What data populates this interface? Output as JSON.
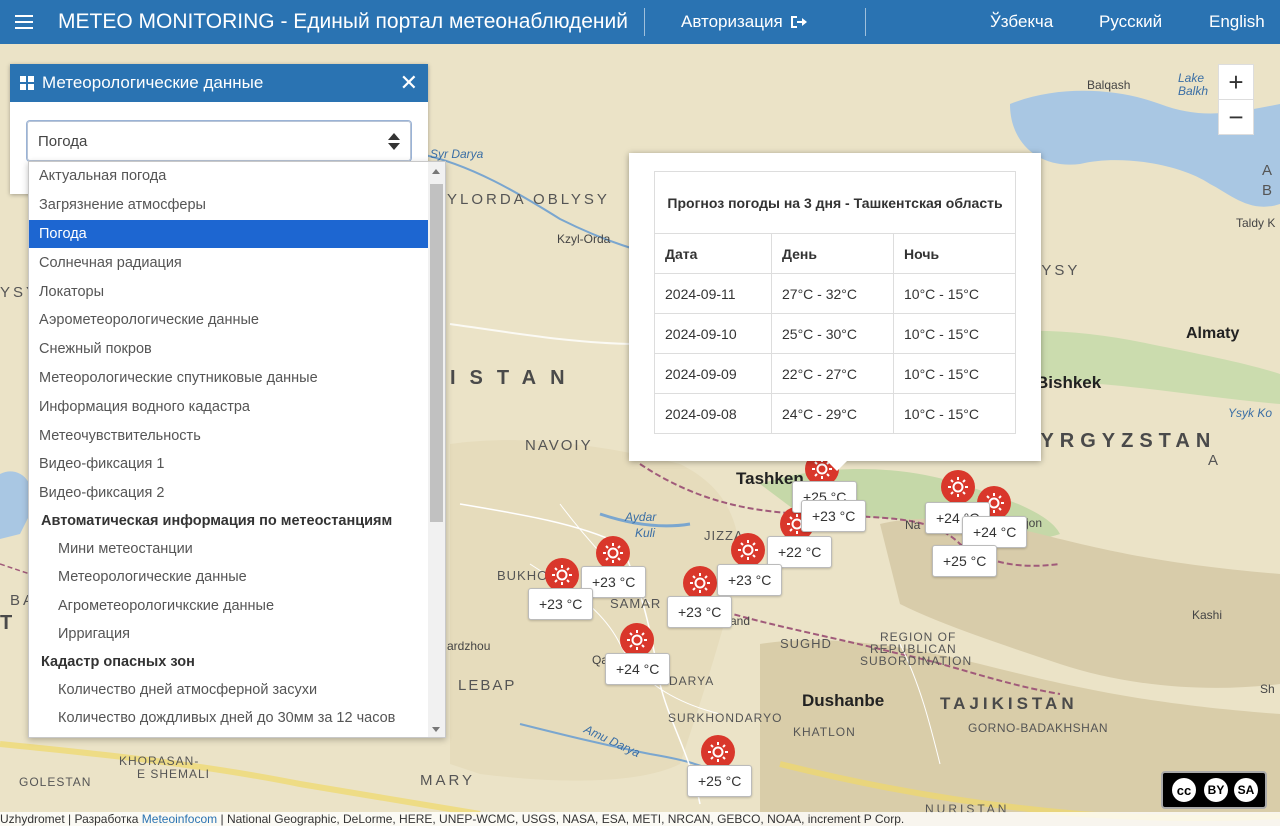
{
  "header": {
    "title": "METEO MONITORING - Единый портал метеонаблюдений",
    "login_label": "Авторизация",
    "languages": [
      "Ўзбекча",
      "Русский",
      "English"
    ]
  },
  "panel": {
    "title": "Метеорологические данные",
    "select_value": "Погода"
  },
  "dropdown": {
    "items": [
      "Актуальная погода",
      "Загрязнение атмосферы",
      "Погода",
      "Солнечная радиация",
      "Локаторы",
      "Аэрометеорологические данные",
      "Снежный покров",
      "Метеорологические спутниковые данные",
      "Информация водного кадастра",
      "Метеочувствительность",
      "Видео-фиксация 1",
      "Видео-фиксация 2"
    ],
    "selected_index": 2,
    "group1": {
      "title": "Автоматическая информация по метеостанциям",
      "items": [
        "Мини метеостанции",
        "Метеорологические данные",
        "Агрометеорологичкские данные",
        "Ирригация"
      ]
    },
    "group2": {
      "title": "Кадастр опасных зон",
      "items": [
        "Количество дней атмосферной засухи",
        "Количество дождливых дней до 30мм за 12 часов"
      ]
    }
  },
  "forecast": {
    "title": "Прогноз погоды на 3 дня - Ташкентская область",
    "headers": [
      "Дата",
      "День",
      "Ночь"
    ],
    "rows": [
      [
        "2024-09-11",
        "27°C - 32°C",
        "10°C - 15°C"
      ],
      [
        "2024-09-10",
        "25°C - 30°C",
        "10°C - 15°C"
      ],
      [
        "2024-09-09",
        "22°C - 27°C",
        "10°C - 15°C"
      ],
      [
        "2024-09-08",
        "24°C - 29°C",
        "10°C - 15°C"
      ]
    ]
  },
  "map": {
    "zoom_in": "+",
    "zoom_out": "−",
    "labels": {
      "balqash": "Balqash",
      "lake": "Lake",
      "balkhash": "Balkh",
      "kzylorda_region": "YLORDA OBLYSY",
      "kzylorda": "Kzyl-Orda",
      "syr_darya": "Syr Darya",
      "taldy": "Taldy K",
      "zhambyl": "ZHAMBYL OBLYSY",
      "almaty": "Almaty",
      "bishkek": "Bishkek",
      "ysyk": "Ysyk Ko",
      "kyrgyzstan": "KYRGYZSTAN",
      "istan": "ISTAN",
      "navoiy": "NAVOIY",
      "tashkent": "Tashken",
      "aydar": "Aydar",
      "kuli": "Kuli",
      "jizzakh": "JIZZA",
      "bukhoro": "BUKHOR",
      "samar": "SAMAR",
      "and": "and",
      "sughd": "SUGHD",
      "rrs1": "REGION OF",
      "rrs2": "REPUBLICAN",
      "rrs3": "SUBORDINATION",
      "ardzhou": "ardzhou",
      "lebap": "LEBAP",
      "qa": "Qa",
      "adarya": "ADARYA",
      "surkhondaryo": "SURKHONDARYO",
      "dushanbe": "Dushanbe",
      "tajikistan": "TAJIKISTAN",
      "gbao": "GORNO-BADAKHSHAN",
      "khatlon": "KHATLON",
      "amu": "Amu Darya",
      "kashi": "Kashi",
      "khorasan1": "KHORASAN-",
      "khorasan2": "E SHEMALI",
      "golestan": "GOLESTAN",
      "mary": "MARY",
      "nuristan": "NURISTAN",
      "ysy": "YSY",
      "ba": "BA",
      "t": "T",
      "sh": "Sh",
      "a": "A",
      "a2": "A",
      "b": "B",
      "jon": "jon",
      "na": "Na"
    },
    "stations": [
      {
        "temp": "+23 °C"
      },
      {
        "temp": "+23 °C"
      },
      {
        "temp": "+22 °C"
      },
      {
        "temp": "+23 °C"
      },
      {
        "temp": "+23 °C"
      },
      {
        "temp": "+23 °C"
      },
      {
        "temp": "+24 °C"
      },
      {
        "temp": "+24 °C"
      },
      {
        "temp": "+24 °C"
      },
      {
        "temp": "+25 °C"
      },
      {
        "temp": "+25 °C"
      },
      {
        "temp": "+25 °C"
      }
    ]
  },
  "attribution": {
    "prefix": "Uzhydromet | Разработка ",
    "link": "Meteoinfocom",
    "suffix": " | National Geographic, DeLorme, HERE, UNEP-WCMC, USGS, NASA, ESA, METI, NRCAN, GEBCO, NOAA, increment P Corp."
  },
  "license": {
    "by": "BY",
    "sa": "SA",
    "cc": "cc"
  }
}
